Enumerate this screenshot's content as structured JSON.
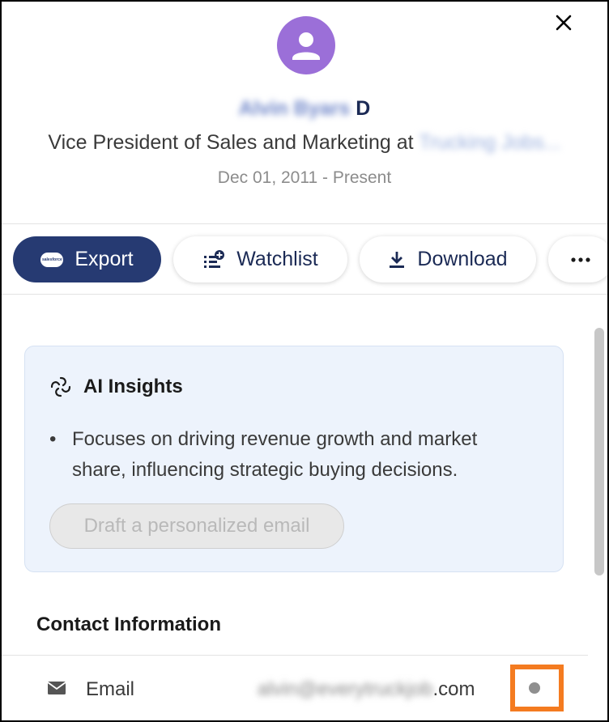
{
  "header": {
    "close_icon": "close-icon",
    "avatar_icon": "person-icon",
    "avatar_color": "#9b6fd8",
    "name": "Alvin Byars",
    "badge_letter": "D",
    "title_prefix": "Vice President of Sales and Marketing at",
    "company": "Trucking Jobs...",
    "date_range": "Dec 01, 2011 - Present"
  },
  "actions": {
    "export_label": "Export",
    "export_icon": "salesforce-cloud-icon",
    "export_icon_text": "salesforce",
    "watchlist_label": "Watchlist",
    "watchlist_icon": "add-list-icon",
    "download_label": "Download",
    "download_icon": "download-icon",
    "more_icon": "more-horizontal-icon",
    "accent": "#263a72"
  },
  "ai_insights": {
    "title": "AI Insights",
    "icon": "ai-insights-icon",
    "bullet_mark": "•",
    "bullet": "Focuses on driving revenue growth and market share, influencing strategic buying decisions.",
    "draft_button": "Draft a personalized email"
  },
  "contact": {
    "title": "Contact Information",
    "email_icon": "envelope-icon",
    "email_label": "Email",
    "email_value_blurred": "alvin@everytruckjob",
    "email_value_suffix": ".com",
    "highlight_color": "#f47b20"
  }
}
